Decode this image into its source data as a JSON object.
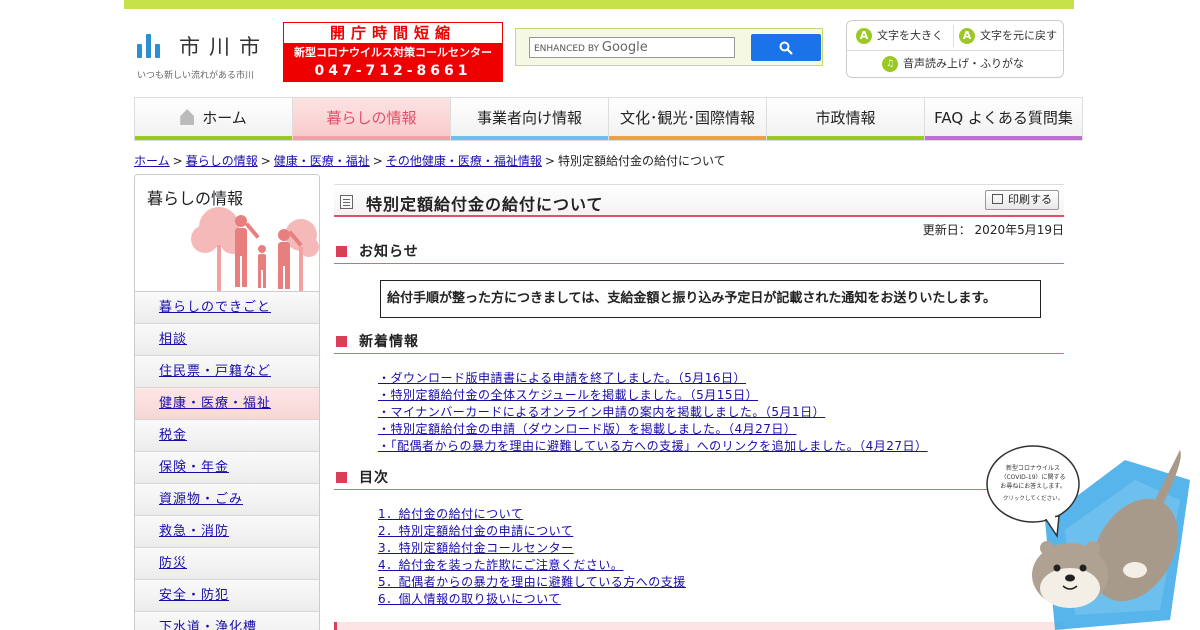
{
  "header": {
    "logo_name": "市川市",
    "logo_tagline": "いつも新しい流れがある市川",
    "notice": {
      "line1": "開庁時間短縮",
      "line2": "新型コロナウイルス対策コールセンター",
      "line3": "047-712-8661"
    },
    "search": {
      "placeholder_prefix": "ENHANCED BY",
      "placeholder_brand": "Google"
    },
    "accessibility": {
      "larger": "文字を大きく",
      "reset": "文字を元に戻す",
      "voice": "音声読み上げ・ふりがな",
      "icon_letter": "A"
    }
  },
  "nav": {
    "tabs": [
      {
        "label": "ホーム",
        "color": "#9cc824"
      },
      {
        "label": "暮らしの情報",
        "color": "#f5a0a8"
      },
      {
        "label": "事業者向け情報",
        "color": "#6ec0e8"
      },
      {
        "label": "文化･観光･国際情報",
        "color": "#f0a040"
      },
      {
        "label": "市政情報",
        "color": "#9cc824"
      },
      {
        "label": "FAQ よくある質問集",
        "color": "#c070d0"
      }
    ]
  },
  "breadcrumb": {
    "items": [
      "ホーム",
      "暮らしの情報",
      "健康・医療・福祉",
      "その他健康・医療・福祉情報"
    ],
    "separator": ">",
    "current": "特別定額給付金の給付について"
  },
  "sidebar": {
    "title": "暮らしの情報",
    "items": [
      "暮らしのできごと",
      "相談",
      "住民票・戸籍など",
      "健康・医療・福祉",
      "税金",
      "保険・年金",
      "資源物・ごみ",
      "救急・消防",
      "防災",
      "安全・防犯",
      "下水道・浄化槽"
    ]
  },
  "main": {
    "title": "特別定額給付金の給付について",
    "print_label": "印刷する",
    "updated": "更新日： 2020年5月19日",
    "sections": {
      "notice": "お知らせ",
      "news": "新着情報",
      "toc": "目次"
    },
    "notice_text": "給付手順が整った方につきましては、支給金額と振り込み予定日が記載された通知をお送りいたします。",
    "news": [
      "・ダウンロード版申請書による申請を終了しました。（5月16日）",
      "・特別定額給付金の全体スケジュールを掲載しました。（5月15日）",
      "・マイナンバーカードによるオンライン申請の案内を掲載しました。（5月1日）",
      "・特別定額給付金の申請（ダウンロード版）を掲載しました。（4月27日）",
      "・「配偶者からの暴力を理由に避難している方への支援」へのリンクを追加しました。（4月27日）"
    ],
    "toc": [
      "1．給付金の給付について",
      "2．特別定額給付金の申請について",
      "3．特別定額給付金コールセンター",
      "4．給付金を装った詐欺にご注意ください。",
      "5．配偶者からの暴力を理由に避難している方への支援",
      "6．個人情報の取り扱いについて"
    ]
  },
  "mascot": {
    "bubble_line1": "新型コロナウイルス",
    "bubble_line2": "（COVID-19）に関する",
    "bubble_line3": "お尋ねにお答えします。",
    "bubble_line4": "クリックしてください。"
  },
  "colors": {
    "accent": "#d94057",
    "link": "#1a0dab",
    "brand_green": "#9cc824",
    "notice_red": "#ee0000"
  }
}
